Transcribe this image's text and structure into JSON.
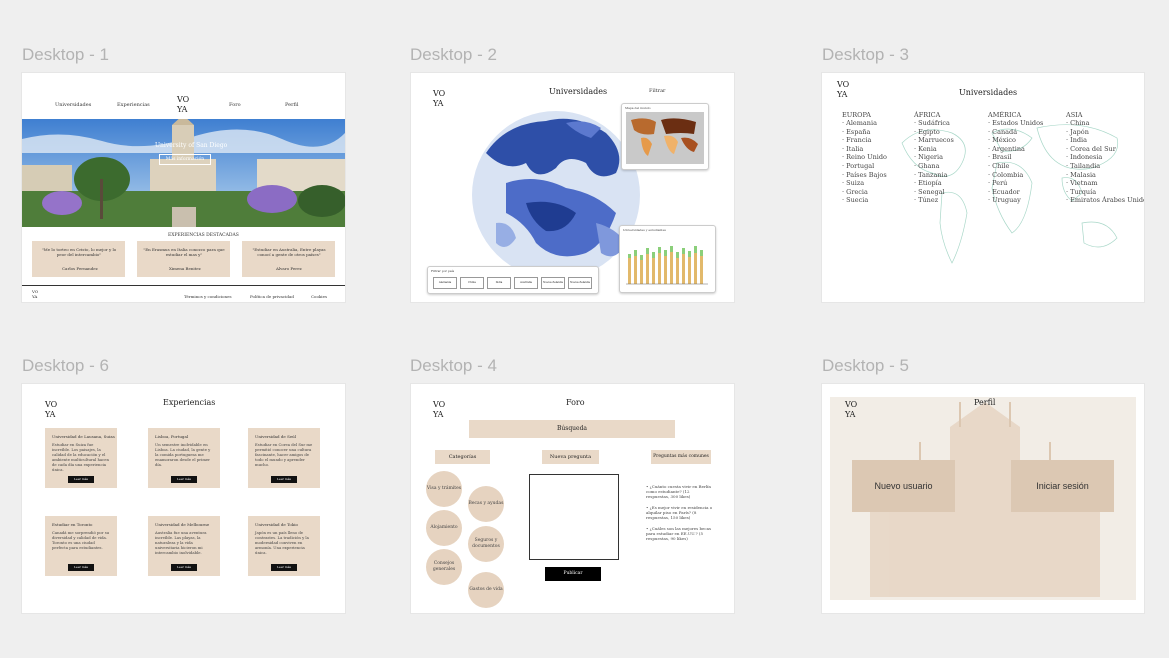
{
  "frames": {
    "d1": "Desktop - 1",
    "d2": "Desktop - 2",
    "d3": "Desktop - 3",
    "d6": "Desktop - 6",
    "d4": "Desktop - 4",
    "d5": "Desktop - 5"
  },
  "logo": [
    "VO",
    "YA"
  ],
  "d1": {
    "nav": [
      "Universidades",
      "Experiencias",
      "Foro",
      "Perfil"
    ],
    "hero_title": "University of San Diego",
    "hero_button": "Más información",
    "section_title": "EXPERIENCIAS DESTACADAS",
    "quotes": [
      {
        "text": "\"Me lo torteo en Cristo, lo mejor y lo peor del intercambio\"",
        "author": "Carlos Fernandez"
      },
      {
        "text": "\"En Erasmus en Italia conozco para que estudiar el mas y\"",
        "author": "Ximena Benitez"
      },
      {
        "text": "\"Estudiar en Australia, Entre playas conocí a gente de otros países\"",
        "author": "Alvaro Perez"
      }
    ],
    "footer": [
      "Términos y condiciones",
      "Política de privacidad",
      "Cookies"
    ]
  },
  "d2": {
    "title": "Universidades",
    "filter": "Filtrar",
    "panel_title": "Filtrar por país",
    "filters": [
      "Alemania",
      "China",
      "India",
      "Australia",
      "Nueva Zelanda",
      "Nueva Zelanda"
    ],
    "map_title": "Mapa del mundo",
    "chart_title": "Universidades y estudiantes"
  },
  "d3": {
    "title": "Universidades",
    "continents": [
      {
        "name": "EUROPA",
        "items": [
          "Alemania",
          "España",
          "Francia",
          "Italia",
          "Reino Unido",
          "Portugal",
          "Países Bajos",
          "Suiza",
          "Grecia",
          "Suecia"
        ]
      },
      {
        "name": "ÁFRICA",
        "items": [
          "Sudáfrica",
          "Egipto",
          "Marruecos",
          "Kenia",
          "Nigeria",
          "Ghana",
          "Tanzania",
          "Etiopía",
          "Senegal",
          "Túnez"
        ]
      },
      {
        "name": "AMÉRICA",
        "items": [
          "Estados Unidos",
          "Canadá",
          "México",
          "Argentina",
          "Brasil",
          "Chile",
          "Colombia",
          "Perú",
          "Ecuador",
          "Uruguay"
        ]
      },
      {
        "name": "ASIA",
        "items": [
          "China",
          "Japón",
          "India",
          "Corea del Sur",
          "Indonesia",
          "Tailandia",
          "Malasia",
          "Vietnam",
          "Turquía",
          "Emiratos Árabes Unidos"
        ]
      }
    ]
  },
  "d6": {
    "title": "Experiencias",
    "cards": [
      {
        "head": "Universidad de Lausana, Suiza",
        "body": "Estudiar en Suiza fue increíble. Los paisajes, la calidad de la educación y el ambiente multicultural hacen de cada día una experiencia única.",
        "btn": "Leer más"
      },
      {
        "head": "Lisboa, Portugal",
        "body": "Un semestre inolvidable en Lisboa. La ciudad, la gente y la comida portuguesa me enamoraron desde el primer día.",
        "btn": "Leer más"
      },
      {
        "head": "Universidad de Seúl",
        "body": "Estudiar en Corea del Sur me permitió conocer una cultura fascinante, hacer amigos de todo el mundo y aprender mucho.",
        "btn": "Leer más"
      },
      {
        "head": "Estudiar en Toronto",
        "body": "Canadá me sorprendió por su diversidad y calidad de vida. Toronto es una ciudad perfecta para estudiantes.",
        "btn": "Leer más"
      },
      {
        "head": "Universidad de Melbourne",
        "body": "Australia fue una aventura increíble. Las playas, la naturaleza y la vida universitaria hicieron mi intercambio inolvidable.",
        "btn": "Leer más"
      },
      {
        "head": "Universidad de Tokio",
        "body": "Japón es un país lleno de contrastes. La tradición y la modernidad conviven en armonía. Una experiencia única.",
        "btn": "Leer más"
      }
    ]
  },
  "d4": {
    "title": "Foro",
    "search": "Búsqueda",
    "categories": "Categorías",
    "new_question": "Nueva pregunta",
    "faq_title": "Preguntas más comunes",
    "circles": [
      "Visa y trámites",
      "Alojamiento",
      "Consejos generales",
      "Becas y ayudas",
      "Seguros y documentos",
      "Gastos de vida",
      "Costo de vida"
    ],
    "publish": "Publicar",
    "faqs": [
      "¿Cuánto cuesta vivir en Berlín como estudiante? (12 respuestas, 300 likes)",
      "¿Es mejor vivir en residencia o alquilar piso en París? (8 respuestas, 150 likes)",
      "¿Cuáles son las mejores becas para estudiar en EE.UU.? (5 respuestas, 90 likes)"
    ]
  },
  "d5": {
    "title": "Perfil",
    "new_user": "Nuevo usuario",
    "login": "Iniciar sesión"
  }
}
